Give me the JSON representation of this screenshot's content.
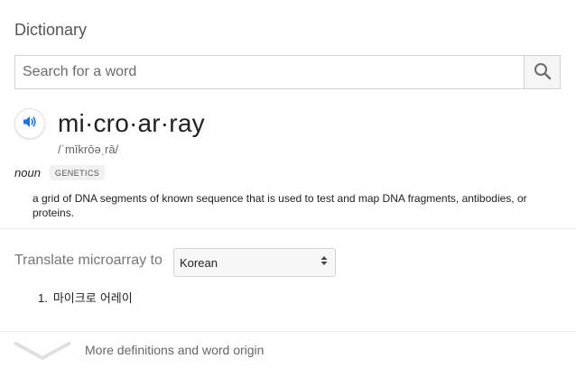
{
  "dictionary": {
    "title": "Dictionary",
    "search": {
      "placeholder": "Search for a word",
      "value": ""
    },
    "entry": {
      "headword": "mi·cro·ar·ray",
      "phonetic": "/ˈmīkrōəˌrā/",
      "part_of_speech": "noun",
      "domain_label": "GENETICS",
      "definition": "a grid of DNA segments of known sequence that is used to test and map DNA fragments, antibodies, or proteins."
    },
    "translate": {
      "label": "Translate microarray to",
      "selected_language": "Korean",
      "results": [
        {
          "index": "1.",
          "text": "마이크로 어레이"
        }
      ]
    },
    "footer": {
      "more_label": "More definitions and word origin"
    },
    "icons": {
      "search": "search-icon",
      "audio": "speaker-icon",
      "select_arrow": "up-down-arrows-icon",
      "expand": "chevron-down-icon"
    },
    "colors": {
      "accent_blue": "#1a73e8",
      "icon_gray": "#777777",
      "badge_bg": "#f1f1f1"
    }
  }
}
